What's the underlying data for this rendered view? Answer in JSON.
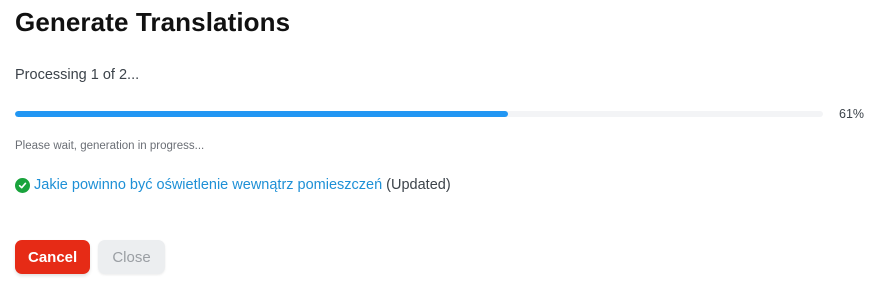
{
  "dialog": {
    "title": "Generate Translations",
    "status": "Processing 1 of 2...",
    "progress": {
      "value": 61,
      "label": "61%",
      "color": "#2196f3"
    },
    "hint": "Please wait, generation in progress...",
    "results": [
      {
        "icon": "check-circle-icon",
        "icon_color": "#19a33c",
        "link_text": "Jakie powinno być oświetlenie wewnątrz pomieszczeń",
        "suffix": "(Updated)"
      }
    ],
    "buttons": {
      "cancel_label": "Cancel",
      "cancel_color": "#e62b16",
      "close_label": "Close"
    }
  }
}
